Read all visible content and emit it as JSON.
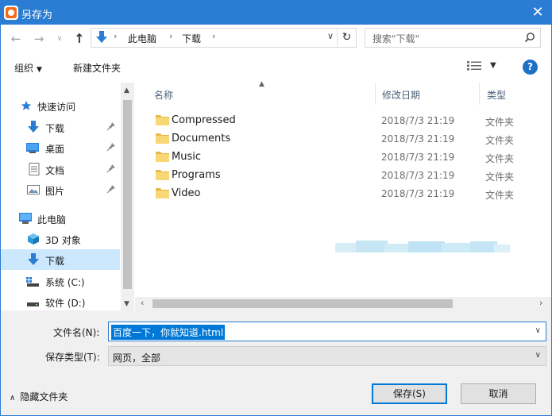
{
  "window": {
    "title": "另存为",
    "close_glyph": "✕"
  },
  "address": {
    "crumbs": [
      "此电脑",
      "下载"
    ],
    "separator": "›",
    "search_placeholder": "搜索\"下载\""
  },
  "toolbar": {
    "organize_label": "组织",
    "new_folder_label": "新建文件夹"
  },
  "nav": {
    "quick_access": "快速访问",
    "quick_items": [
      {
        "label": "下载",
        "icon": "download-arrow-icon"
      },
      {
        "label": "桌面",
        "icon": "desktop-icon"
      },
      {
        "label": "文档",
        "icon": "document-icon"
      },
      {
        "label": "图片",
        "icon": "picture-icon"
      }
    ],
    "this_pc": "此电脑",
    "pc_items": [
      {
        "label": "3D 对象",
        "icon": "3d-objects-icon"
      },
      {
        "label": "下载",
        "icon": "download-arrow-icon",
        "selected": true
      },
      {
        "label": "系统 (C:)",
        "icon": "system-drive-icon"
      },
      {
        "label": "软件 (D:)",
        "icon": "drive-icon"
      }
    ]
  },
  "list": {
    "columns": {
      "name": "名称",
      "date": "修改日期",
      "type": "类型"
    },
    "rows": [
      {
        "name": "Compressed",
        "date": "2018/7/3 21:19",
        "type": "文件夹"
      },
      {
        "name": "Documents",
        "date": "2018/7/3 21:19",
        "type": "文件夹"
      },
      {
        "name": "Music",
        "date": "2018/7/3 21:19",
        "type": "文件夹"
      },
      {
        "name": "Programs",
        "date": "2018/7/3 21:19",
        "type": "文件夹"
      },
      {
        "name": "Video",
        "date": "2018/7/3 21:19",
        "type": "文件夹"
      }
    ]
  },
  "form": {
    "filename_label": "文件名(N):",
    "filename_value": "百度一下，你就知道.html",
    "type_label": "保存类型(T):",
    "type_value": "网页，全部",
    "hide_folders_label": "隐藏文件夹",
    "save_label": "保存(S)",
    "cancel_label": "取消"
  },
  "colors": {
    "accent": "#2b7cd3",
    "selection": "#0078d7",
    "folder": "#f8d775"
  }
}
